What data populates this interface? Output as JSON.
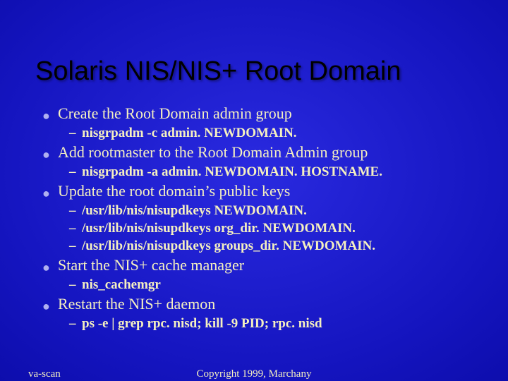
{
  "title": "Solaris NIS/NIS+ Root Domain",
  "items": [
    {
      "text": "Create the Root Domain admin group",
      "sub": [
        "nisgrpadm  -c   admin. NEWDOMAIN."
      ]
    },
    {
      "text": "Add rootmaster to the Root Domain Admin group",
      "sub": [
        "nisgrpadm   -a   admin. NEWDOMAIN.  HOSTNAME."
      ]
    },
    {
      "text": "Update the root domain’s public keys",
      "sub": [
        "/usr/lib/nis/nisupdkeys  NEWDOMAIN.",
        "/usr/lib/nis/nisupdkeys  org_dir. NEWDOMAIN.",
        "/usr/lib/nis/nisupdkeys  groups_dir. NEWDOMAIN."
      ]
    },
    {
      "text": "Start the NIS+ cache manager",
      "sub": [
        "nis_cachemgr"
      ]
    },
    {
      "text": "Restart the NIS+ daemon",
      "sub": [
        "ps   -e | grep rpc. nisd; kill -9 PID;  rpc. nisd"
      ]
    }
  ],
  "footer": {
    "left": "va-scan",
    "center": "Copyright 1999, Marchany"
  }
}
